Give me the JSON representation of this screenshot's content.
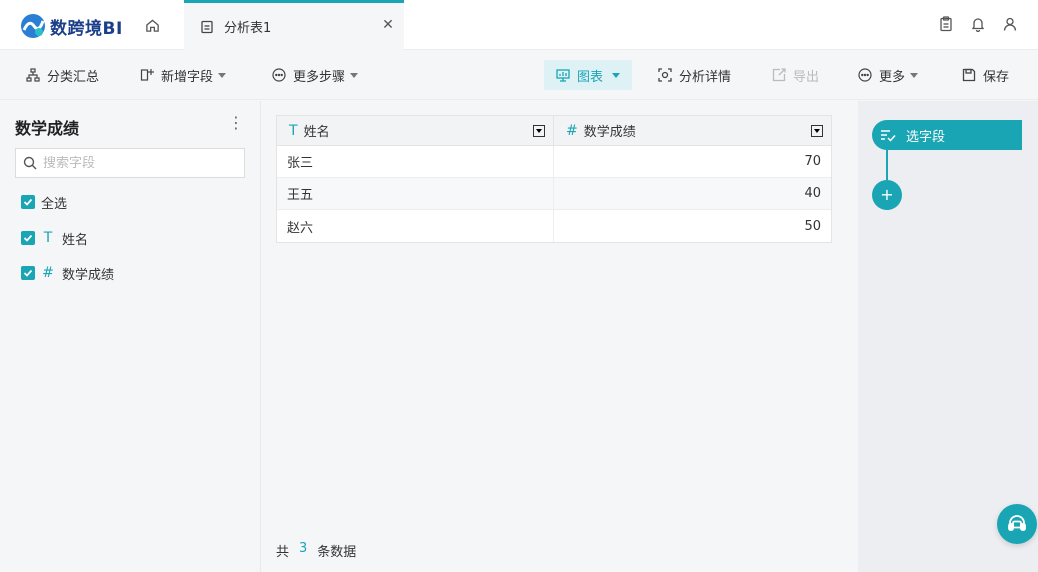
{
  "app": {
    "logo_text": "数跨境BI"
  },
  "tabs": [
    {
      "label": "分析表1"
    }
  ],
  "toolbar": {
    "group_summary": "分类汇总",
    "add_field": "新增字段",
    "more_steps": "更多步骤",
    "chart": "图表",
    "analysis_detail": "分析详情",
    "export": "导出",
    "more": "更多",
    "save": "保存"
  },
  "left_panel": {
    "title": "数学成绩",
    "search_placeholder": "搜索字段",
    "select_all": "全选",
    "fields": [
      {
        "type_icon": "T",
        "label": "姓名"
      },
      {
        "type_icon": "#",
        "label": "数学成绩"
      }
    ]
  },
  "table": {
    "columns": [
      {
        "type_icon": "T",
        "label": "姓名"
      },
      {
        "type_icon": "#",
        "label": "数学成绩"
      }
    ],
    "rows": [
      [
        "张三",
        "70"
      ],
      [
        "王五",
        "40"
      ],
      [
        "赵六",
        "50"
      ]
    ],
    "footer_prefix": "共",
    "row_count": "3",
    "footer_suffix": "条数据"
  },
  "steps": {
    "select_fields": "选字段",
    "add_step": "+"
  },
  "colors": {
    "accent": "#1aa5b5",
    "logo": "#1c3f8a"
  }
}
